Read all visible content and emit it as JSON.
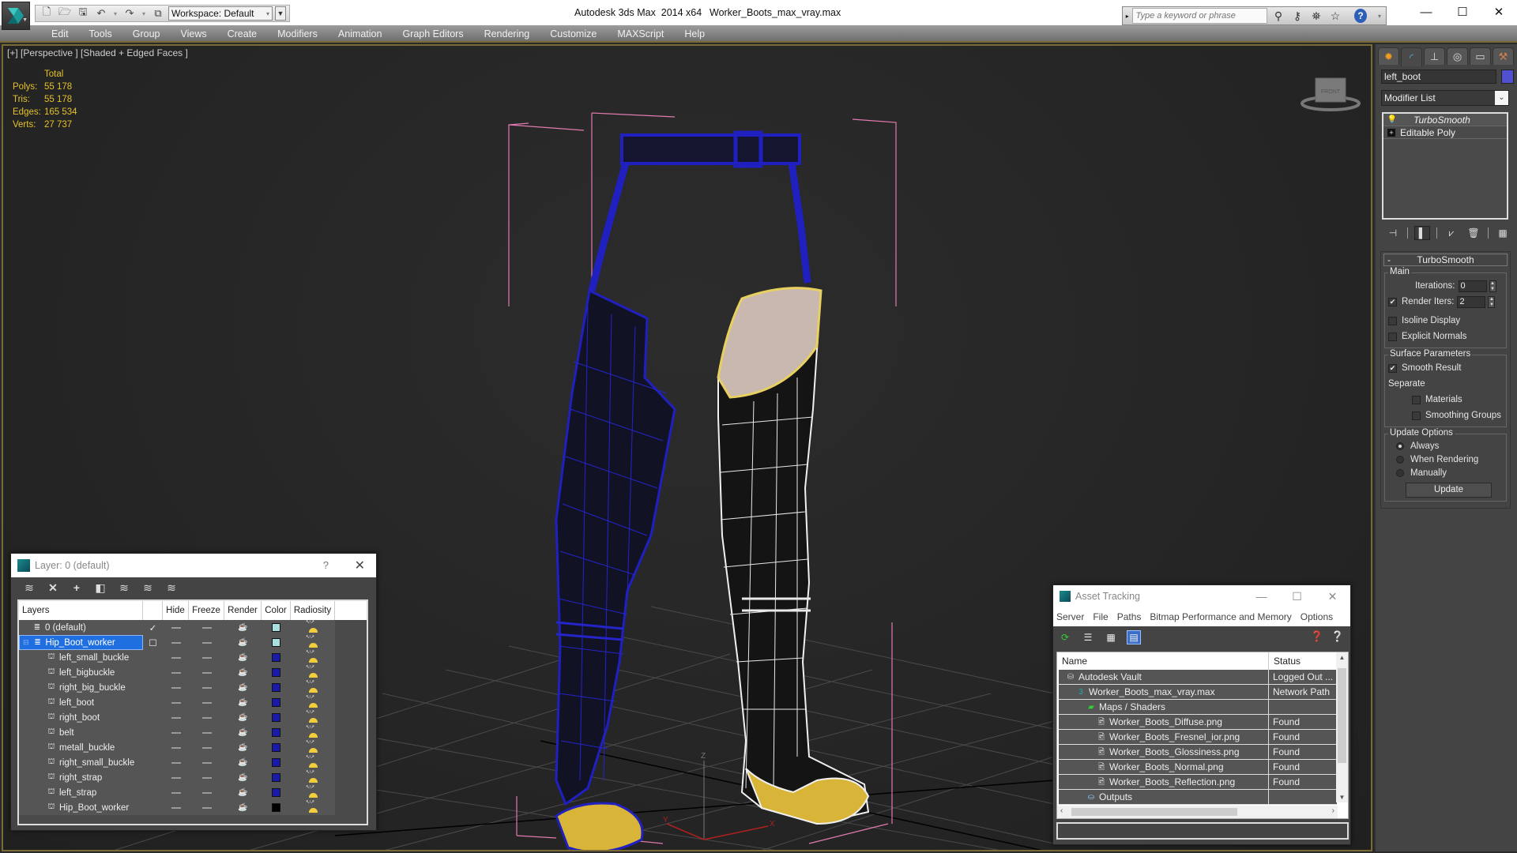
{
  "app": {
    "title": "Autodesk 3ds Max  2014 x64",
    "file": "Worker_Boots_max_vray.max",
    "workspace": "Workspace: Default",
    "search_placeholder": "Type a keyword or phrase"
  },
  "menu": [
    "Edit",
    "Tools",
    "Group",
    "Views",
    "Create",
    "Modifiers",
    "Animation",
    "Graph Editors",
    "Rendering",
    "Customize",
    "MAXScript",
    "Help"
  ],
  "viewport": {
    "label": "[+] [Perspective ] [Shaded + Edged Faces ]",
    "viewcube_label": "FRONT",
    "stats": {
      "header": "Total",
      "rows": [
        {
          "k": "Polys:",
          "v": "55 178"
        },
        {
          "k": "Tris:",
          "v": "55 178"
        },
        {
          "k": "Edges:",
          "v": "165 534"
        },
        {
          "k": "Verts:",
          "v": "27 737"
        }
      ]
    },
    "axis_labels": {
      "x": "X",
      "y": "Y",
      "z": "Z"
    }
  },
  "command_panel": {
    "object_name": "left_boot",
    "object_color": "#5050d0",
    "modifier_list": "Modifier List",
    "stack": [
      "TurboSmooth",
      "Editable Poly"
    ],
    "rollout": {
      "title": "TurboSmooth",
      "main_group": "Main",
      "iterations_label": "Iterations:",
      "iterations_value": "0",
      "render_iters_label": "Render Iters:",
      "render_iters_value": "2",
      "render_iters_checked": true,
      "isoline_label": "Isoline Display",
      "explicit_normals_label": "Explicit Normals",
      "surface_group": "Surface Parameters",
      "smooth_result_label": "Smooth Result",
      "separate_label": "Separate",
      "materials_label": "Materials",
      "smoothing_groups_label": "Smoothing Groups",
      "update_group": "Update Options",
      "update_options": [
        "Always",
        "When Rendering",
        "Manually"
      ],
      "update_selected": "Always",
      "update_button": "Update"
    }
  },
  "layer_dialog": {
    "title": "Layer: 0 (default)",
    "help": "?",
    "columns": [
      "Layers",
      "",
      "Hide",
      "Freeze",
      "Render",
      "Color",
      "Radiosity"
    ],
    "rows": [
      {
        "name": "0 (default)",
        "type": "layer",
        "current": "✓",
        "color": "#a8e0e0"
      },
      {
        "name": "Hip_Boot_worker",
        "type": "layer",
        "selected": true,
        "current": "☐",
        "color": "#a8e0e0"
      },
      {
        "name": "left_small_buckle",
        "type": "obj",
        "color": "#1a1aa8"
      },
      {
        "name": "left_bigbuckle",
        "type": "obj",
        "color": "#1a1aa8"
      },
      {
        "name": "right_big_buckle",
        "type": "obj",
        "color": "#1a1aa8"
      },
      {
        "name": "left_boot",
        "type": "obj",
        "color": "#1a1aa8"
      },
      {
        "name": "right_boot",
        "type": "obj",
        "color": "#1a1aa8"
      },
      {
        "name": "belt",
        "type": "obj",
        "color": "#1a1aa8"
      },
      {
        "name": "metall_buckle",
        "type": "obj",
        "color": "#1a1aa8"
      },
      {
        "name": "right_small_buckle",
        "type": "obj",
        "color": "#1a1aa8"
      },
      {
        "name": "right_strap",
        "type": "obj",
        "color": "#1a1aa8"
      },
      {
        "name": "left_strap",
        "type": "obj",
        "color": "#1a1aa8"
      },
      {
        "name": "Hip_Boot_worker",
        "type": "obj",
        "color": "#000000"
      }
    ]
  },
  "asset_tracking": {
    "title": "Asset Tracking",
    "menu": [
      "Server",
      "File",
      "Paths",
      "Bitmap Performance and Memory",
      "Options"
    ],
    "columns": [
      "Name",
      "Status"
    ],
    "rows": [
      {
        "name": "Autodesk Vault",
        "status": "Logged Out ...",
        "level": 1,
        "icon": "vault-icon"
      },
      {
        "name": "Worker_Boots_max_vray.max",
        "status": "Network Path",
        "level": 2,
        "icon": "max-file-icon"
      },
      {
        "name": "Maps / Shaders",
        "status": "",
        "level": 3,
        "icon": "maps-icon"
      },
      {
        "name": "Worker_Boots_Diffuse.png",
        "status": "Found",
        "level": 4,
        "icon": "image-file-icon"
      },
      {
        "name": "Worker_Boots_Fresnel_ior.png",
        "status": "Found",
        "level": 4,
        "icon": "image-file-icon"
      },
      {
        "name": "Worker_Boots_Glossiness.png",
        "status": "Found",
        "level": 4,
        "icon": "image-file-icon"
      },
      {
        "name": "Worker_Boots_Normal.png",
        "status": "Found",
        "level": 4,
        "icon": "image-file-icon"
      },
      {
        "name": "Worker_Boots_Reflection.png",
        "status": "Found",
        "level": 4,
        "icon": "image-file-icon"
      },
      {
        "name": "Outputs",
        "status": "",
        "level": 3,
        "icon": "outputs-icon"
      }
    ]
  }
}
